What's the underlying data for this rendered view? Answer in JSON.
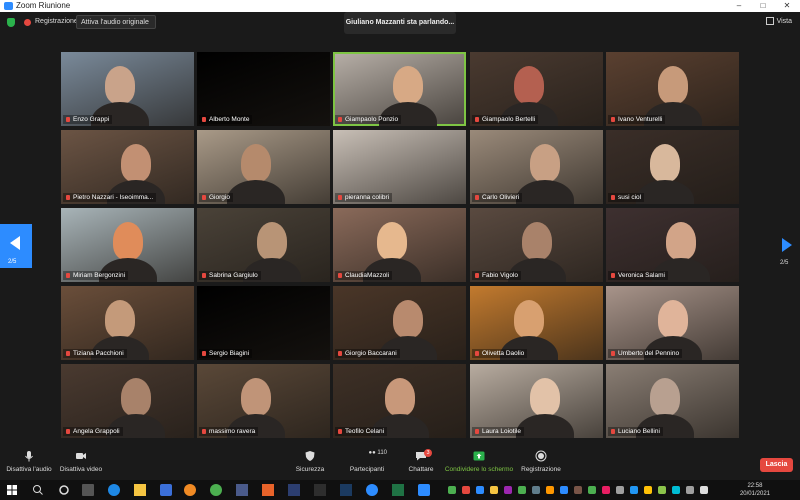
{
  "window": {
    "title": "Zoom Riunione",
    "minimize": "–",
    "maximize": "□",
    "close": "✕"
  },
  "meetbar": {
    "rec_label": "Registrazione",
    "audio_select": "Attiva l'audio originale",
    "speaking": "Giuliano Mazzanti sta parlando...",
    "view": "Vista"
  },
  "pager": {
    "left": "2/5",
    "right": "2/5"
  },
  "participants": [
    {
      "name": "Enzo Grappi",
      "bg": "#7a8a9a",
      "face": "#c9a38a"
    },
    {
      "name": "Alberto Monte",
      "bg": "#000000",
      "face": ""
    },
    {
      "name": "Giampaolo Ponzio",
      "bg": "#b8b0a8",
      "face": "#d7a985"
    },
    {
      "name": "Giampaolo Bertelli",
      "bg": "#4a3a30",
      "face": "#b46050"
    },
    {
      "name": "Ivano Venturelli",
      "bg": "#5a4030",
      "face": "#c79a7a"
    },
    {
      "name": "Pietro Nazzari - Iseoimma...",
      "bg": "#6b5444",
      "face": "#c29073"
    },
    {
      "name": "Giorgio",
      "bg": "#a99a88",
      "face": "#b58a6c"
    },
    {
      "name": "pieranna colibri",
      "bg": "#c8bfb6",
      "face": ""
    },
    {
      "name": "Carlo Olivieri",
      "bg": "#9a8a7a",
      "face": "#c8a084"
    },
    {
      "name": "susi ciol",
      "bg": "#3a2e28",
      "face": "#d8b89c"
    },
    {
      "name": "Miriam Bergonzini",
      "bg": "#a8b4b8",
      "face": "#e08c5a"
    },
    {
      "name": "Sabrina Gargiulo",
      "bg": "#4a4238",
      "face": "#b89476"
    },
    {
      "name": "ClaudiaMazzoli",
      "bg": "#8a6a5a",
      "face": "#e6b88e"
    },
    {
      "name": "Fabio Vigolo",
      "bg": "#5a4a40",
      "face": "#a9826a"
    },
    {
      "name": "Veronica Salami",
      "bg": "#3e3030",
      "face": "#d2a488"
    },
    {
      "name": "Tiziana Pacchioni",
      "bg": "#6a4e3a",
      "face": "#c49a7a"
    },
    {
      "name": "Sergio Biagini",
      "bg": "#000000",
      "face": ""
    },
    {
      "name": "Giorgio Baccarani",
      "bg": "#4a3628",
      "face": "#b88a6e"
    },
    {
      "name": "Olivetta Daolio",
      "bg": "#c27a2e",
      "face": "#d8a070"
    },
    {
      "name": "Umberto del Pennino",
      "bg": "#a8948a",
      "face": "#e0b49a"
    },
    {
      "name": "Angela Grappoli",
      "bg": "#4a3a30",
      "face": "#a8826a"
    },
    {
      "name": "massimo ravera",
      "bg": "#5a4838",
      "face": "#c09478"
    },
    {
      "name": "Teofilo Celani",
      "bg": "#3e3026",
      "face": "#c8987a"
    },
    {
      "name": "Laura Loiotile",
      "bg": "#b8aca0",
      "face": "#e2c2a8"
    },
    {
      "name": "Luciano Bellini",
      "bg": "#8a7e74",
      "face": "#b8a090"
    }
  ],
  "toolbar": {
    "mute": "Disattiva l'audio",
    "video": "Disattiva video",
    "security": "Sicurezza",
    "participants": "Partecipanti",
    "participants_count": "110",
    "chat": "Chattare",
    "chat_badge": "3",
    "share": "Condividere lo schermo",
    "record": "Registrazione",
    "leave": "Lascia"
  },
  "taskbar": {
    "time": "22:58",
    "date": "20/01/2021"
  },
  "colors": {
    "accent": "#2d8cff",
    "danger": "#e5483f",
    "share": "#2bb24c",
    "active_speaker": "#7ec544"
  }
}
